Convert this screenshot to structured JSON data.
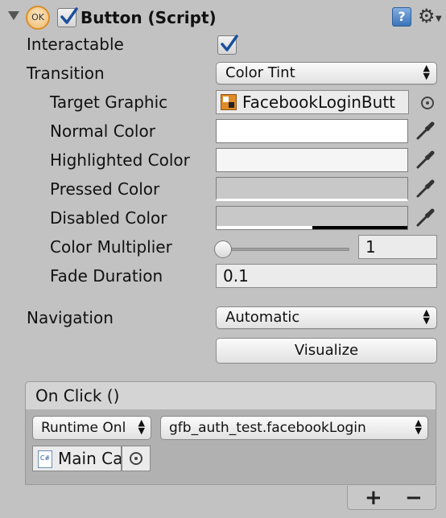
{
  "header": {
    "title": "Button (Script)",
    "ok_badge": "OK",
    "enabled": true,
    "help_icon_glyph": "?",
    "gear_icon_glyph": "⚙"
  },
  "fields": {
    "interactable": {
      "label": "Interactable",
      "checked": true
    },
    "transition": {
      "label": "Transition",
      "value": "Color Tint"
    },
    "target_graphic": {
      "label": "Target Graphic",
      "value": "FacebookLoginButt"
    },
    "normal_color": {
      "label": "Normal Color",
      "color": "#ffffff"
    },
    "highlighted_color": {
      "label": "Highlighted Color",
      "color": "#f5f5f5"
    },
    "pressed_color": {
      "label": "Pressed Color",
      "color": "#c8c8c8"
    },
    "disabled_color": {
      "label": "Disabled Color",
      "color": "#c8c8c8",
      "alpha_bar_color": "#000000",
      "alpha": 0.5
    },
    "color_multiplier": {
      "label": "Color Multiplier",
      "value": "1",
      "slider_fraction": 0
    },
    "fade_duration": {
      "label": "Fade Duration",
      "value": "0.1"
    },
    "navigation": {
      "label": "Navigation",
      "value": "Automatic"
    }
  },
  "visualize_button": "Visualize",
  "on_click": {
    "header": "On Click ()",
    "runtime_option": "Runtime Onl",
    "function": "gfb_auth_test.facebookLogin",
    "target_object": "Main Ca",
    "script_icon_text": "C#",
    "add_button": "+",
    "remove_button": "−"
  },
  "colors": {
    "panel_bg": "#c2c2c2",
    "checkbox_check": "#1b4f9c"
  }
}
